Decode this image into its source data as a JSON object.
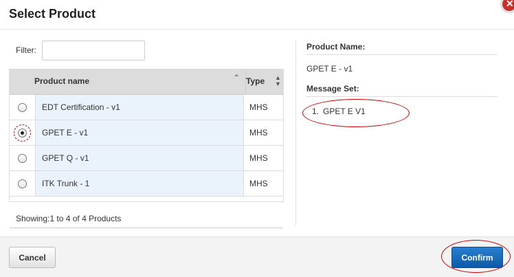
{
  "dialog": {
    "title": "Select Product",
    "close_icon": "close-icon"
  },
  "filter": {
    "label": "Filter:",
    "value": "",
    "placeholder": ""
  },
  "table": {
    "columns": [
      "Product name",
      "Type"
    ],
    "sort_icons": [
      "sort-ascending-icon",
      "sort-both-icon"
    ],
    "rows": [
      {
        "name": "EDT Certification - v1",
        "type": "MHS",
        "selected": false
      },
      {
        "name": "GPET E - v1",
        "type": "MHS",
        "selected": true
      },
      {
        "name": "GPET Q - v1",
        "type": "MHS",
        "selected": false
      },
      {
        "name": "ITK Trunk - 1",
        "type": "MHS",
        "selected": false
      }
    ],
    "showing": "Showing:1 to 4 of 4 Products"
  },
  "details": {
    "product_name_label": "Product Name:",
    "product_name_value": "GPET E - v1",
    "message_set_label": "Message Set:",
    "message_set_items": [
      {
        "num": "1.",
        "text": "GPET E V1"
      }
    ]
  },
  "footer": {
    "cancel_label": "Cancel",
    "confirm_label": "Confirm"
  },
  "colors": {
    "confirm_bg": "#1565b5",
    "close_bg": "#c9302c",
    "row_highlight": "#eaf2fb",
    "annotation_red": "#cc0000"
  }
}
